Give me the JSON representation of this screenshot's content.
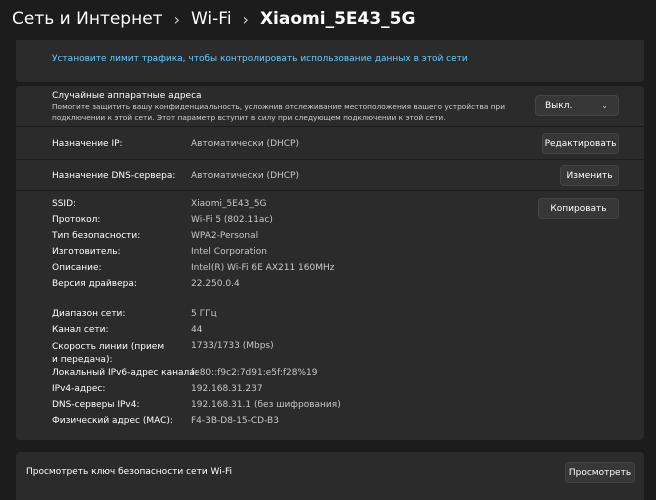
{
  "breadcrumb": {
    "items": [
      "Сеть и Интернет",
      "Wi-Fi"
    ],
    "current": "Xiaomi_5E43_5G",
    "separator": "›"
  },
  "traffic_limit": {
    "link": "Установите лимит трафика, чтобы контролировать использование данных в этой сети"
  },
  "random_mac": {
    "title": "Случайные аппаратные адреса",
    "description": "Помогите защитить вашу конфиденциальность, усложнив отслеживание местоположения вашего устройства при подключении к этой сети. Этот параметр вступит в силу при следующем подключении к этой сети.",
    "dropdown_value": "Выкл."
  },
  "ip": {
    "label": "Назначение IP:",
    "value": "Автоматически (DHCP)",
    "button": "Редактировать"
  },
  "dns": {
    "label": "Назначение DNS-сервера:",
    "value": "Автоматически (DHCP)",
    "button": "Изменить"
  },
  "props": {
    "copy_button": "Копировать",
    "rows": [
      {
        "label": "SSID:",
        "value": "Xiaomi_5E43_5G"
      },
      {
        "label": "Протокол:",
        "value": "Wi-Fi 5 (802.11ac)"
      },
      {
        "label": "Тип безопасности:",
        "value": "WPA2-Personal"
      },
      {
        "label": "Изготовитель:",
        "value": "Intel Corporation"
      },
      {
        "label": "Описание:",
        "value": "Intel(R) Wi-Fi 6E AX211 160MHz"
      },
      {
        "label": "Версия драйвера:",
        "value": "22.250.0.4"
      },
      {
        "label": "Диапазон сети:",
        "value": "5 ГГц"
      },
      {
        "label": "Канал сети:",
        "value": "44"
      },
      {
        "label": "Скорость линии (прием и передача):",
        "value": "1733/1733 (Mbps)"
      },
      {
        "label": "Локальный IPv6-адрес канала:",
        "value": "fe80::f9c2:7d91:e5f:f28%19"
      },
      {
        "label": "IPv4-адрес:",
        "value": "192.168.31.237"
      },
      {
        "label": "DNS-серверы IPv4:",
        "value": "192.168.31.1 (без шифрования)"
      },
      {
        "label": "Физический адрес (MAC):",
        "value": "F4-3B-D8-15-CD-B3"
      }
    ]
  },
  "security_key": {
    "label": "Просмотреть ключ безопасности сети Wi-Fi",
    "button": "Просмотреть"
  }
}
